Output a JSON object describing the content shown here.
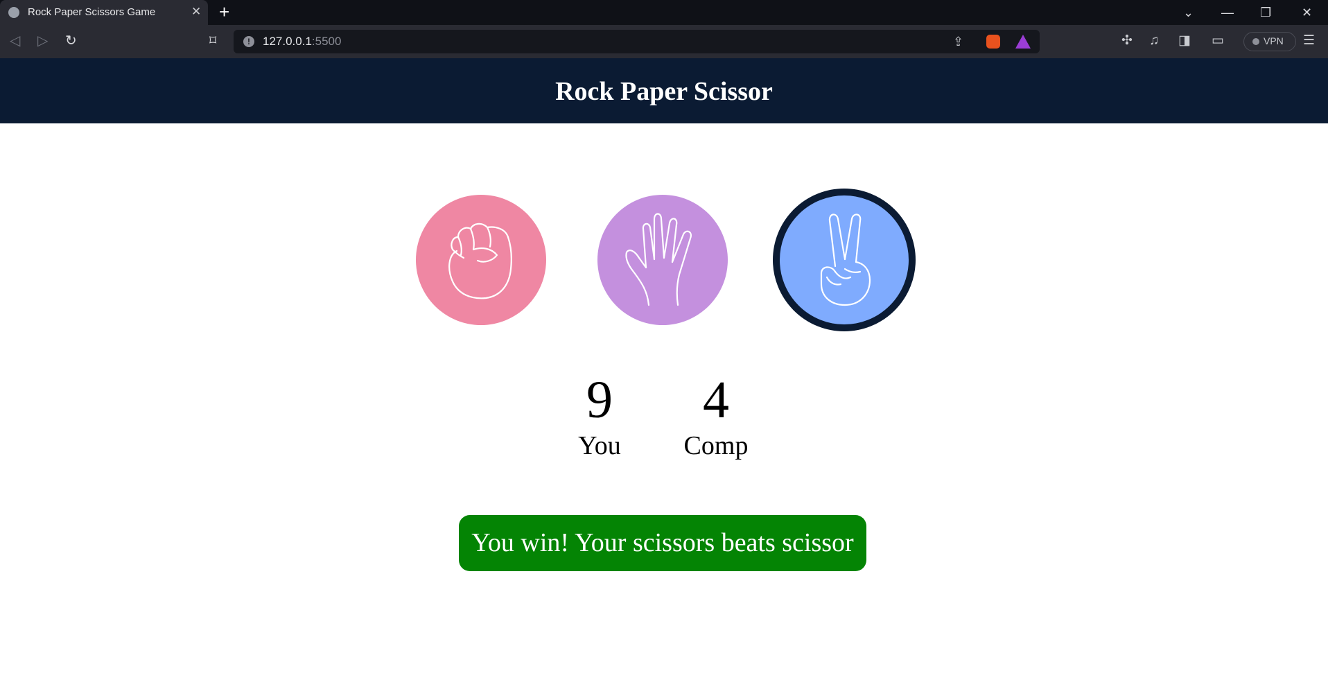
{
  "browser": {
    "tab_title": "Rock Paper Scissors Game",
    "tab_close": "✕",
    "new_tab": "+",
    "url_host": "127.0.0.1",
    "url_port": ":5500",
    "vpn_label": "VPN",
    "window_controls": {
      "tab_list": "⌄",
      "minimize": "—",
      "restore": "❐",
      "close": "✕"
    }
  },
  "page": {
    "title": "Rock Paper Scissor",
    "choices": [
      {
        "name": "rock",
        "icon": "rock-hand-icon",
        "color": "#ef87a3"
      },
      {
        "name": "paper",
        "icon": "paper-hand-icon",
        "color": "#c490de"
      },
      {
        "name": "scissors",
        "icon": "scissors-hand-icon",
        "color": "#7fabfe",
        "selected": true
      }
    ],
    "scoreboard": {
      "user_score": "9",
      "user_label": "You",
      "comp_score": "4",
      "comp_label": "Comp"
    },
    "message": "You win! Your scissors beats scissor",
    "colors": {
      "header_bg": "#0b1b33",
      "message_bg": "#048404"
    }
  }
}
